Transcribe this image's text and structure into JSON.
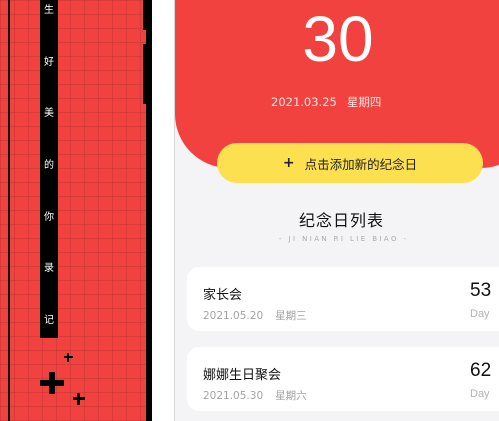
{
  "left_panel": {
    "vertical_text_chars": [
      "生",
      "好",
      "美",
      "的",
      "你",
      "录",
      "记"
    ]
  },
  "header": {
    "day_count": "30",
    "date": "2021.03.25",
    "weekday": "星期四",
    "background_color": "#f2423f"
  },
  "add_button": {
    "icon": "plus-icon",
    "label": "点击添加新的纪念日",
    "color": "#fde04f"
  },
  "list_section": {
    "title": "纪念日列表",
    "subtitle": "- JI NIAN RI LIE BIAO -"
  },
  "anniversaries": [
    {
      "name": "家长会",
      "date": "2021.05.20",
      "weekday": "星期三",
      "count": "53",
      "unit": "Day"
    },
    {
      "name": "娜娜生日聚会",
      "date": "2021.05.30",
      "weekday": "星期六",
      "count": "62",
      "unit": "Day"
    }
  ]
}
